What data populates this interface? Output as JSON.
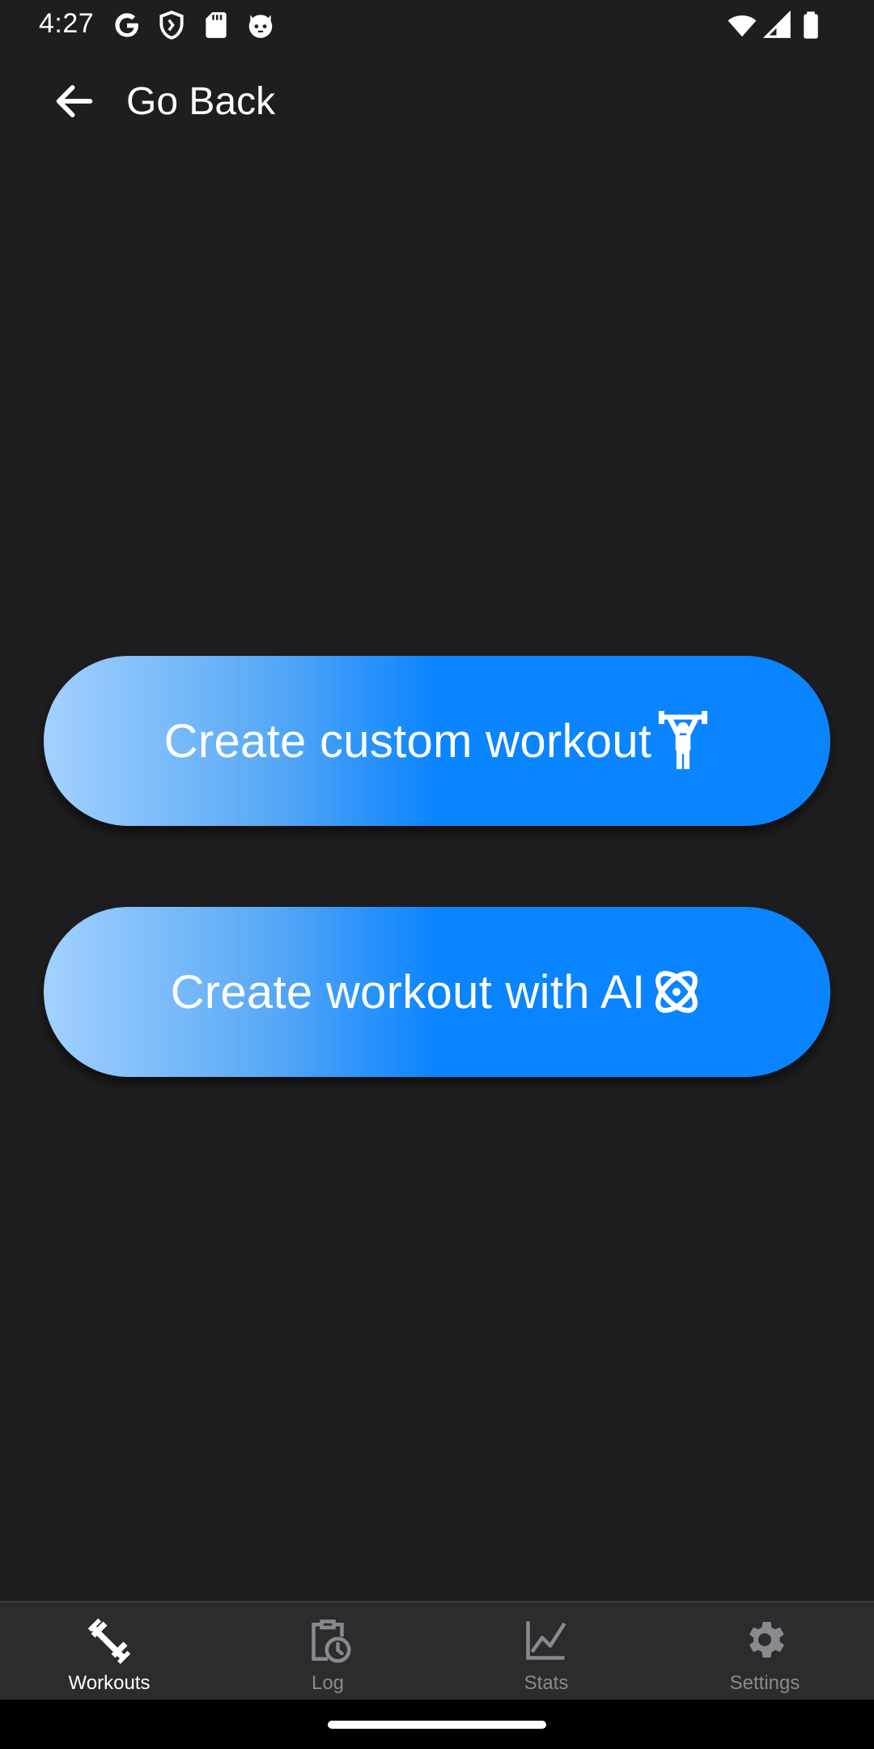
{
  "status_bar": {
    "time": "4:27",
    "left_icons": [
      "google-icon",
      "shield-icon",
      "sd-card-icon",
      "cat-icon"
    ],
    "right_icons": [
      "wifi-icon",
      "signal-icon",
      "battery-icon"
    ]
  },
  "top_bar": {
    "back_label": "Go Back",
    "back_icon": "arrow-left-icon"
  },
  "actions": {
    "custom_workout": {
      "label": "Create custom workout",
      "icon": "weightlifter-icon"
    },
    "ai_workout": {
      "label": "Create workout with AI",
      "icon": "atom-icon"
    }
  },
  "bottom_nav": {
    "items": [
      {
        "label": "Workouts",
        "icon": "dumbbell-icon",
        "active": true
      },
      {
        "label": "Log",
        "icon": "clipboard-clock-icon",
        "active": false
      },
      {
        "label": "Stats",
        "icon": "line-chart-icon",
        "active": false
      },
      {
        "label": "Settings",
        "icon": "gear-icon",
        "active": false
      }
    ]
  },
  "colors": {
    "background": "#1e1e20",
    "accent": "#0a84ff",
    "accent_light": "#a3d1ff",
    "nav_background": "#2c2c2e",
    "nav_inactive": "#8a8a8e"
  }
}
